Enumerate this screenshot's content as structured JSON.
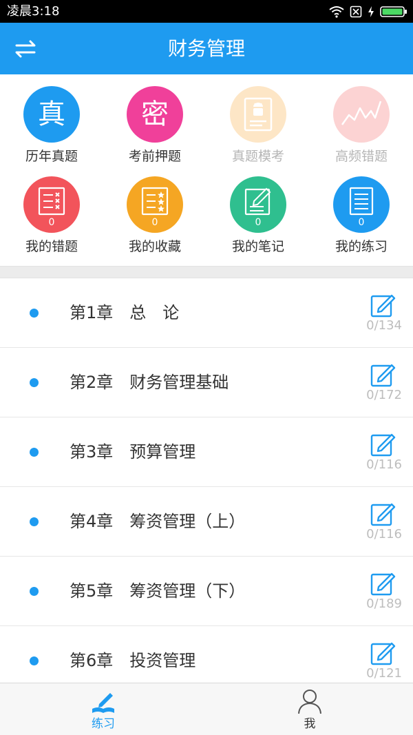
{
  "status": {
    "time": "凌晨3:18"
  },
  "header": {
    "title": "财务管理"
  },
  "grid": [
    {
      "label": "历年真题",
      "glyph": "真",
      "color": "#1e9bf0",
      "enabled": true
    },
    {
      "label": "考前押题",
      "glyph": "密",
      "color": "#f0409a",
      "enabled": true
    },
    {
      "label": "真题模考",
      "color": "#fde6c6",
      "enabled": false
    },
    {
      "label": "高频错题",
      "color": "#fcd3d3",
      "enabled": false
    },
    {
      "label": "我的错题",
      "count": "0",
      "color": "#f2545b",
      "enabled": true
    },
    {
      "label": "我的收藏",
      "count": "0",
      "color": "#f5a623",
      "enabled": true
    },
    {
      "label": "我的笔记",
      "count": "0",
      "color": "#2fbf8f",
      "enabled": true
    },
    {
      "label": "我的练习",
      "count": "0",
      "color": "#1e9bf0",
      "enabled": true
    }
  ],
  "chapters": [
    {
      "title": "第1章　总　论",
      "progress": "0/134"
    },
    {
      "title": "第2章　财务管理基础",
      "progress": "0/172"
    },
    {
      "title": "第3章　预算管理",
      "progress": "0/116"
    },
    {
      "title": "第4章　筹资管理（上）",
      "progress": "0/116"
    },
    {
      "title": "第5章　筹资管理（下）",
      "progress": "0/189"
    },
    {
      "title": "第6章　投资管理",
      "progress": "0/121"
    }
  ],
  "tabs": {
    "practice": "练习",
    "me": "我"
  },
  "colors": {
    "accent": "#1e9bf0"
  }
}
